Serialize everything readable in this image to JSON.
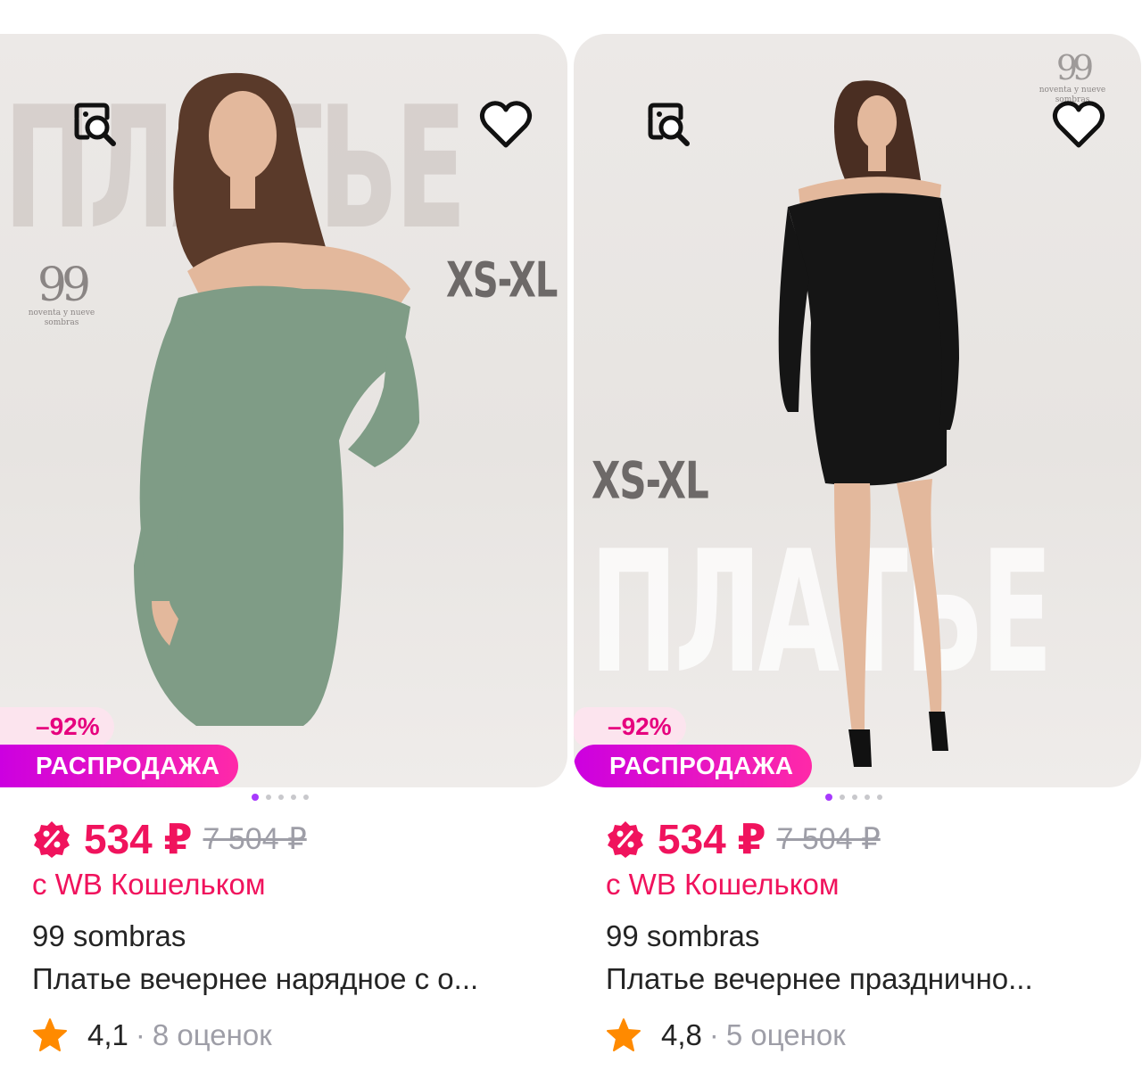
{
  "products": [
    {
      "bg_word": "ПЛАТЬЕ",
      "size_range": "XS-XL",
      "logo_number": "99",
      "logo_caption_1": "noventa y nueve",
      "logo_caption_2": "sombras",
      "dress_color": "#7f9c86",
      "discount": "–92%",
      "sale_label": "РАСПРОДАЖА",
      "price": "534 ₽",
      "old_price": "7 504 ₽",
      "wallet_note": "с WB Кошельком",
      "brand": "99 sombras",
      "title": "Платье вечернее нарядное с о...",
      "rating": "4,1",
      "reviews": "8 оценок"
    },
    {
      "bg_word": "ПЛАТЬЕ",
      "size_range": "XS-XL",
      "logo_number": "99",
      "logo_caption_1": "noventa y nueve",
      "logo_caption_2": "sombras",
      "dress_color": "#151515",
      "discount": "–92%",
      "sale_label": "РАСПРОДАЖА",
      "price": "534 ₽",
      "old_price": "7 504 ₽",
      "wallet_note": "с WB Кошельком",
      "brand": "99 sombras",
      "title": "Платье вечернее празднично...",
      "rating": "4,8",
      "reviews": "5 оценок"
    }
  ],
  "icons": {
    "similar": "image-search-icon",
    "favorite": "heart-icon",
    "price_badge": "percent-badge-icon",
    "rating": "star-icon"
  },
  "colors": {
    "price": "#f0135d",
    "sale_gradient_start": "#cc00e0",
    "sale_gradient_end": "#ff29a8",
    "discount_bg": "#fce4ee",
    "star": "#ff8a00",
    "dot_active": "#a73afd"
  },
  "gallery": {
    "slides": 5,
    "active": 1
  }
}
